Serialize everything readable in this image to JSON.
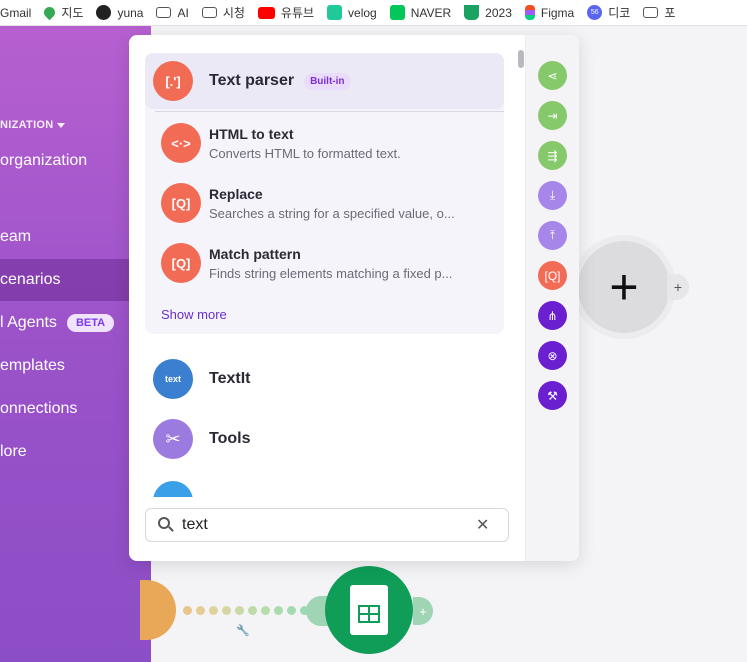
{
  "bookmarks": [
    {
      "label": "Gmail",
      "icon": "gmail-icon"
    },
    {
      "label": "지도",
      "icon": "map-pin-icon"
    },
    {
      "label": "yuna",
      "icon": "github-icon"
    },
    {
      "label": "AI",
      "icon": "folder-icon"
    },
    {
      "label": "시청",
      "icon": "folder-icon"
    },
    {
      "label": "유튜브",
      "icon": "youtube-icon"
    },
    {
      "label": "velog",
      "icon": "velog-icon"
    },
    {
      "label": "NAVER",
      "icon": "naver-icon"
    },
    {
      "label": "2023",
      "icon": "cup-icon"
    },
    {
      "label": "Figma",
      "icon": "figma-icon"
    },
    {
      "label": "디코",
      "icon": "discord-icon",
      "badge": "56"
    },
    {
      "label": "포",
      "icon": "folder-icon"
    }
  ],
  "sidebar": {
    "org_label": "NIZATION",
    "org_name": "organization",
    "items": [
      {
        "label": "eam",
        "active": false
      },
      {
        "label": "cenarios",
        "active": true
      },
      {
        "label": "l Agents",
        "badge": "BETA",
        "active": false
      },
      {
        "label": "emplates",
        "active": false
      },
      {
        "label": "onnections",
        "active": false
      },
      {
        "label": "lore",
        "active": false
      }
    ]
  },
  "panel": {
    "group": {
      "title": "Text parser",
      "badge": "Built-in",
      "icon_glyph": "[.']",
      "modules": [
        {
          "title": "HTML to text",
          "desc": "Converts HTML to formatted text.",
          "icon_glyph": "<·>"
        },
        {
          "title": "Replace",
          "desc": "Searches a string for a specified value, o...",
          "icon_glyph": "[Q]"
        },
        {
          "title": "Match pattern",
          "desc": "Finds string elements matching a fixed p...",
          "icon_glyph": "[Q]"
        }
      ],
      "show_more": "Show more"
    },
    "apps": [
      {
        "title": "TextIt",
        "color": "#3a7fd0",
        "icon_glyph": "text"
      },
      {
        "title": "Tools",
        "color": "#9b7be0",
        "icon_glyph": "✂"
      }
    ],
    "search": {
      "value": "text",
      "clear_glyph": "✕"
    }
  },
  "strip_icons": [
    {
      "name": "router-icon",
      "color": "#86c96a",
      "glyph": "⋖"
    },
    {
      "name": "aggregator-icon",
      "color": "#86c96a",
      "glyph": "⇥"
    },
    {
      "name": "iterator-icon",
      "color": "#86c96a",
      "glyph": "⇶"
    },
    {
      "name": "get-variable-icon",
      "color": "#a686e8",
      "glyph": "⤓"
    },
    {
      "name": "set-variable-icon",
      "color": "#a686e8",
      "glyph": "⤒"
    },
    {
      "name": "text-parser-icon",
      "color": "#f26b55",
      "glyph": "[Q]"
    },
    {
      "name": "share-icon",
      "color": "#6a1fd0",
      "glyph": "⋔"
    },
    {
      "name": "compass-icon",
      "color": "#6a1fd0",
      "glyph": "⊗"
    },
    {
      "name": "tools-icon",
      "color": "#6a1fd0",
      "glyph": "⚒"
    }
  ],
  "canvas": {
    "plus_glyph": "+",
    "plus_small_glyph": "+",
    "sheets_plus_glyph": "+",
    "wrench_glyph": "🔧",
    "dot_colors": [
      "#e9c48d",
      "#e5cc95",
      "#dfd39c",
      "#d6d7a0",
      "#cbd9a4",
      "#c0dba8",
      "#b5dcab",
      "#abdcad",
      "#a2dbb0",
      "#9cd9b2",
      "#98d7b3"
    ]
  }
}
